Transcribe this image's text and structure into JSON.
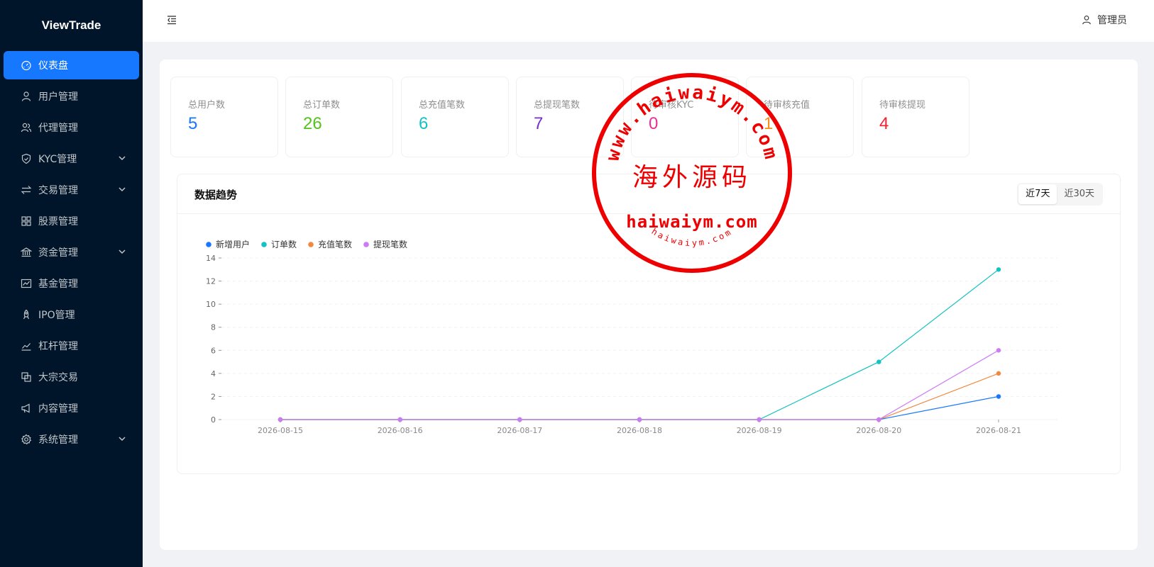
{
  "app": {
    "logo": "ViewTrade"
  },
  "sidebar": {
    "items": [
      {
        "label": "仪表盘",
        "icon": "dashboard-icon",
        "active": true,
        "has_arrow": false
      },
      {
        "label": "用户管理",
        "icon": "user-icon",
        "active": false,
        "has_arrow": false
      },
      {
        "label": "代理管理",
        "icon": "agent-icon",
        "active": false,
        "has_arrow": false
      },
      {
        "label": "KYC管理",
        "icon": "shield-icon",
        "active": false,
        "has_arrow": true
      },
      {
        "label": "交易管理",
        "icon": "swap-icon",
        "active": false,
        "has_arrow": true
      },
      {
        "label": "股票管理",
        "icon": "grid-icon",
        "active": false,
        "has_arrow": false
      },
      {
        "label": "资金管理",
        "icon": "bank-icon",
        "active": false,
        "has_arrow": true
      },
      {
        "label": "基金管理",
        "icon": "fund-chart-icon",
        "active": false,
        "has_arrow": false
      },
      {
        "label": "IPO管理",
        "icon": "rocket-icon",
        "active": false,
        "has_arrow": false
      },
      {
        "label": "杠杆管理",
        "icon": "line-chart-icon",
        "active": false,
        "has_arrow": false
      },
      {
        "label": "大宗交易",
        "icon": "block-icon",
        "active": false,
        "has_arrow": false
      },
      {
        "label": "内容管理",
        "icon": "notification-icon",
        "active": false,
        "has_arrow": false
      },
      {
        "label": "系统管理",
        "icon": "setting-icon",
        "active": false,
        "has_arrow": true
      }
    ]
  },
  "header": {
    "user_label": "管理员"
  },
  "stats": [
    {
      "title": "总用户数",
      "value": "5",
      "color": "#1677ff"
    },
    {
      "title": "总订单数",
      "value": "26",
      "color": "#52c41a"
    },
    {
      "title": "总充值笔数",
      "value": "6",
      "color": "#13c2c2"
    },
    {
      "title": "总提现笔数",
      "value": "7",
      "color": "#722ed1"
    },
    {
      "title": "待审核KYC",
      "value": "0",
      "color": "#eb2f96"
    },
    {
      "title": "待审核充值",
      "value": "1",
      "color": "#fa8c16"
    },
    {
      "title": "待审核提现",
      "value": "4",
      "color": "#f5222d"
    }
  ],
  "trend": {
    "title": "数据趋势",
    "ranges": [
      "近7天",
      "近30天"
    ],
    "active_range": "近7天"
  },
  "chart_data": {
    "type": "line",
    "x": [
      "2026-08-15",
      "2026-08-16",
      "2026-08-17",
      "2026-08-18",
      "2026-08-19",
      "2026-08-20",
      "2026-08-21"
    ],
    "series": [
      {
        "name": "新增用户",
        "color": "#1677ff",
        "values": [
          0,
          0,
          0,
          0,
          0,
          0,
          2
        ]
      },
      {
        "name": "订单数",
        "color": "#13c2c2",
        "values": [
          0,
          0,
          0,
          0,
          0,
          5,
          13
        ]
      },
      {
        "name": "充值笔数",
        "color": "#f0883e",
        "values": [
          0,
          0,
          0,
          0,
          0,
          0,
          4
        ]
      },
      {
        "name": "提现笔数",
        "color": "#cc7af5",
        "values": [
          0,
          0,
          0,
          0,
          0,
          0,
          6
        ]
      }
    ],
    "yticks": [
      "0",
      "2",
      "4",
      "6",
      "8",
      "10",
      "12",
      "14"
    ],
    "ylim": [
      0,
      14
    ],
    "grid": true,
    "legend": "top-left"
  },
  "watermark": {
    "cn": "海外源码",
    "url": "haiwaiym.com",
    "ring_top": "www.haiwaiym.com",
    "ring_bottom": "haiwaiym.com"
  }
}
